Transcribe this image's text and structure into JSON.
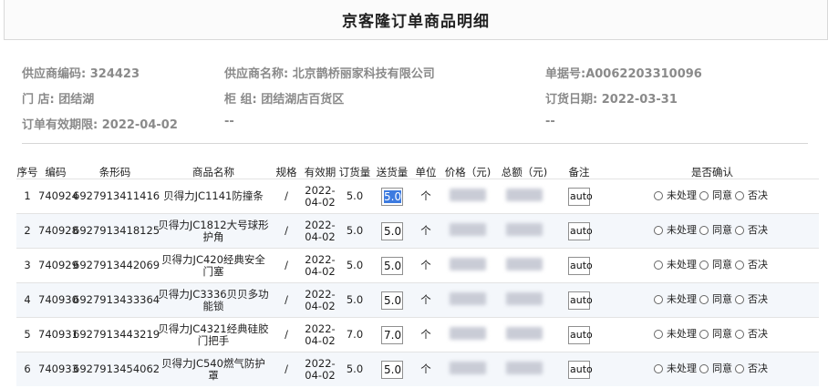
{
  "title": "京客隆订单商品明细",
  "info": {
    "supplier_code_label": "供应商编码:",
    "supplier_code": "324423",
    "supplier_name_label": "供应商名称:",
    "supplier_name": "北京鹊桥丽家科技有限公司",
    "doc_no_label": "单据号:",
    "doc_no": "A0062203310096",
    "store_label": "门 店:",
    "store": "团结湖",
    "counter_label": "柜 组:",
    "counter": "团结湖店百货区",
    "order_date_label": "订货日期:",
    "order_date": "2022-03-31",
    "valid_label": "订单有效期限:",
    "valid": "2022-04-02",
    "dash1": "--",
    "dash2": "--"
  },
  "table": {
    "headers": [
      "序号",
      "编码",
      "条形码",
      "商品名称",
      "规格",
      "有效期",
      "订货量",
      "送货量",
      "单位",
      "价格（元)",
      "总额（元)",
      "备注",
      "是否确认"
    ],
    "radio_options": [
      "未处理",
      "同意",
      "否决"
    ],
    "rows": [
      {
        "no": "1",
        "code": "740924",
        "barcode": "6927913411416",
        "name": "贝得力JC1141防撞条",
        "spec": "/",
        "expiry": "2022-04-02",
        "order_qty": "5.0",
        "deliver_qty": "5.0",
        "unit": "个",
        "note": "auto"
      },
      {
        "no": "2",
        "code": "740928",
        "barcode": "6927913418125",
        "name": "贝得力JC1812大号球形护角",
        "spec": "/",
        "expiry": "2022-04-02",
        "order_qty": "5.0",
        "deliver_qty": "5.0",
        "unit": "个",
        "note": "auto"
      },
      {
        "no": "3",
        "code": "740929",
        "barcode": "6927913442069",
        "name": "贝得力JC420经典安全门塞",
        "spec": "/",
        "expiry": "2022-04-02",
        "order_qty": "5.0",
        "deliver_qty": "5.0",
        "unit": "个",
        "note": "auto"
      },
      {
        "no": "4",
        "code": "740930",
        "barcode": "6927913433364",
        "name": "贝得力JC3336贝贝多功能锁",
        "spec": "/",
        "expiry": "2022-04-02",
        "order_qty": "5.0",
        "deliver_qty": "5.0",
        "unit": "个",
        "note": "auto"
      },
      {
        "no": "5",
        "code": "740931",
        "barcode": "6927913443219",
        "name": "贝得力JC4321经典硅胶门把手",
        "spec": "/",
        "expiry": "2022-04-02",
        "order_qty": "7.0",
        "deliver_qty": "7.0",
        "unit": "个",
        "note": "auto"
      },
      {
        "no": "6",
        "code": "740933",
        "barcode": "6927913454062",
        "name": "贝得力JC540燃气防护罩",
        "spec": "/",
        "expiry": "2022-04-02",
        "order_qty": "5.0",
        "deliver_qty": "5.0",
        "unit": "个",
        "note": "auto"
      }
    ]
  }
}
